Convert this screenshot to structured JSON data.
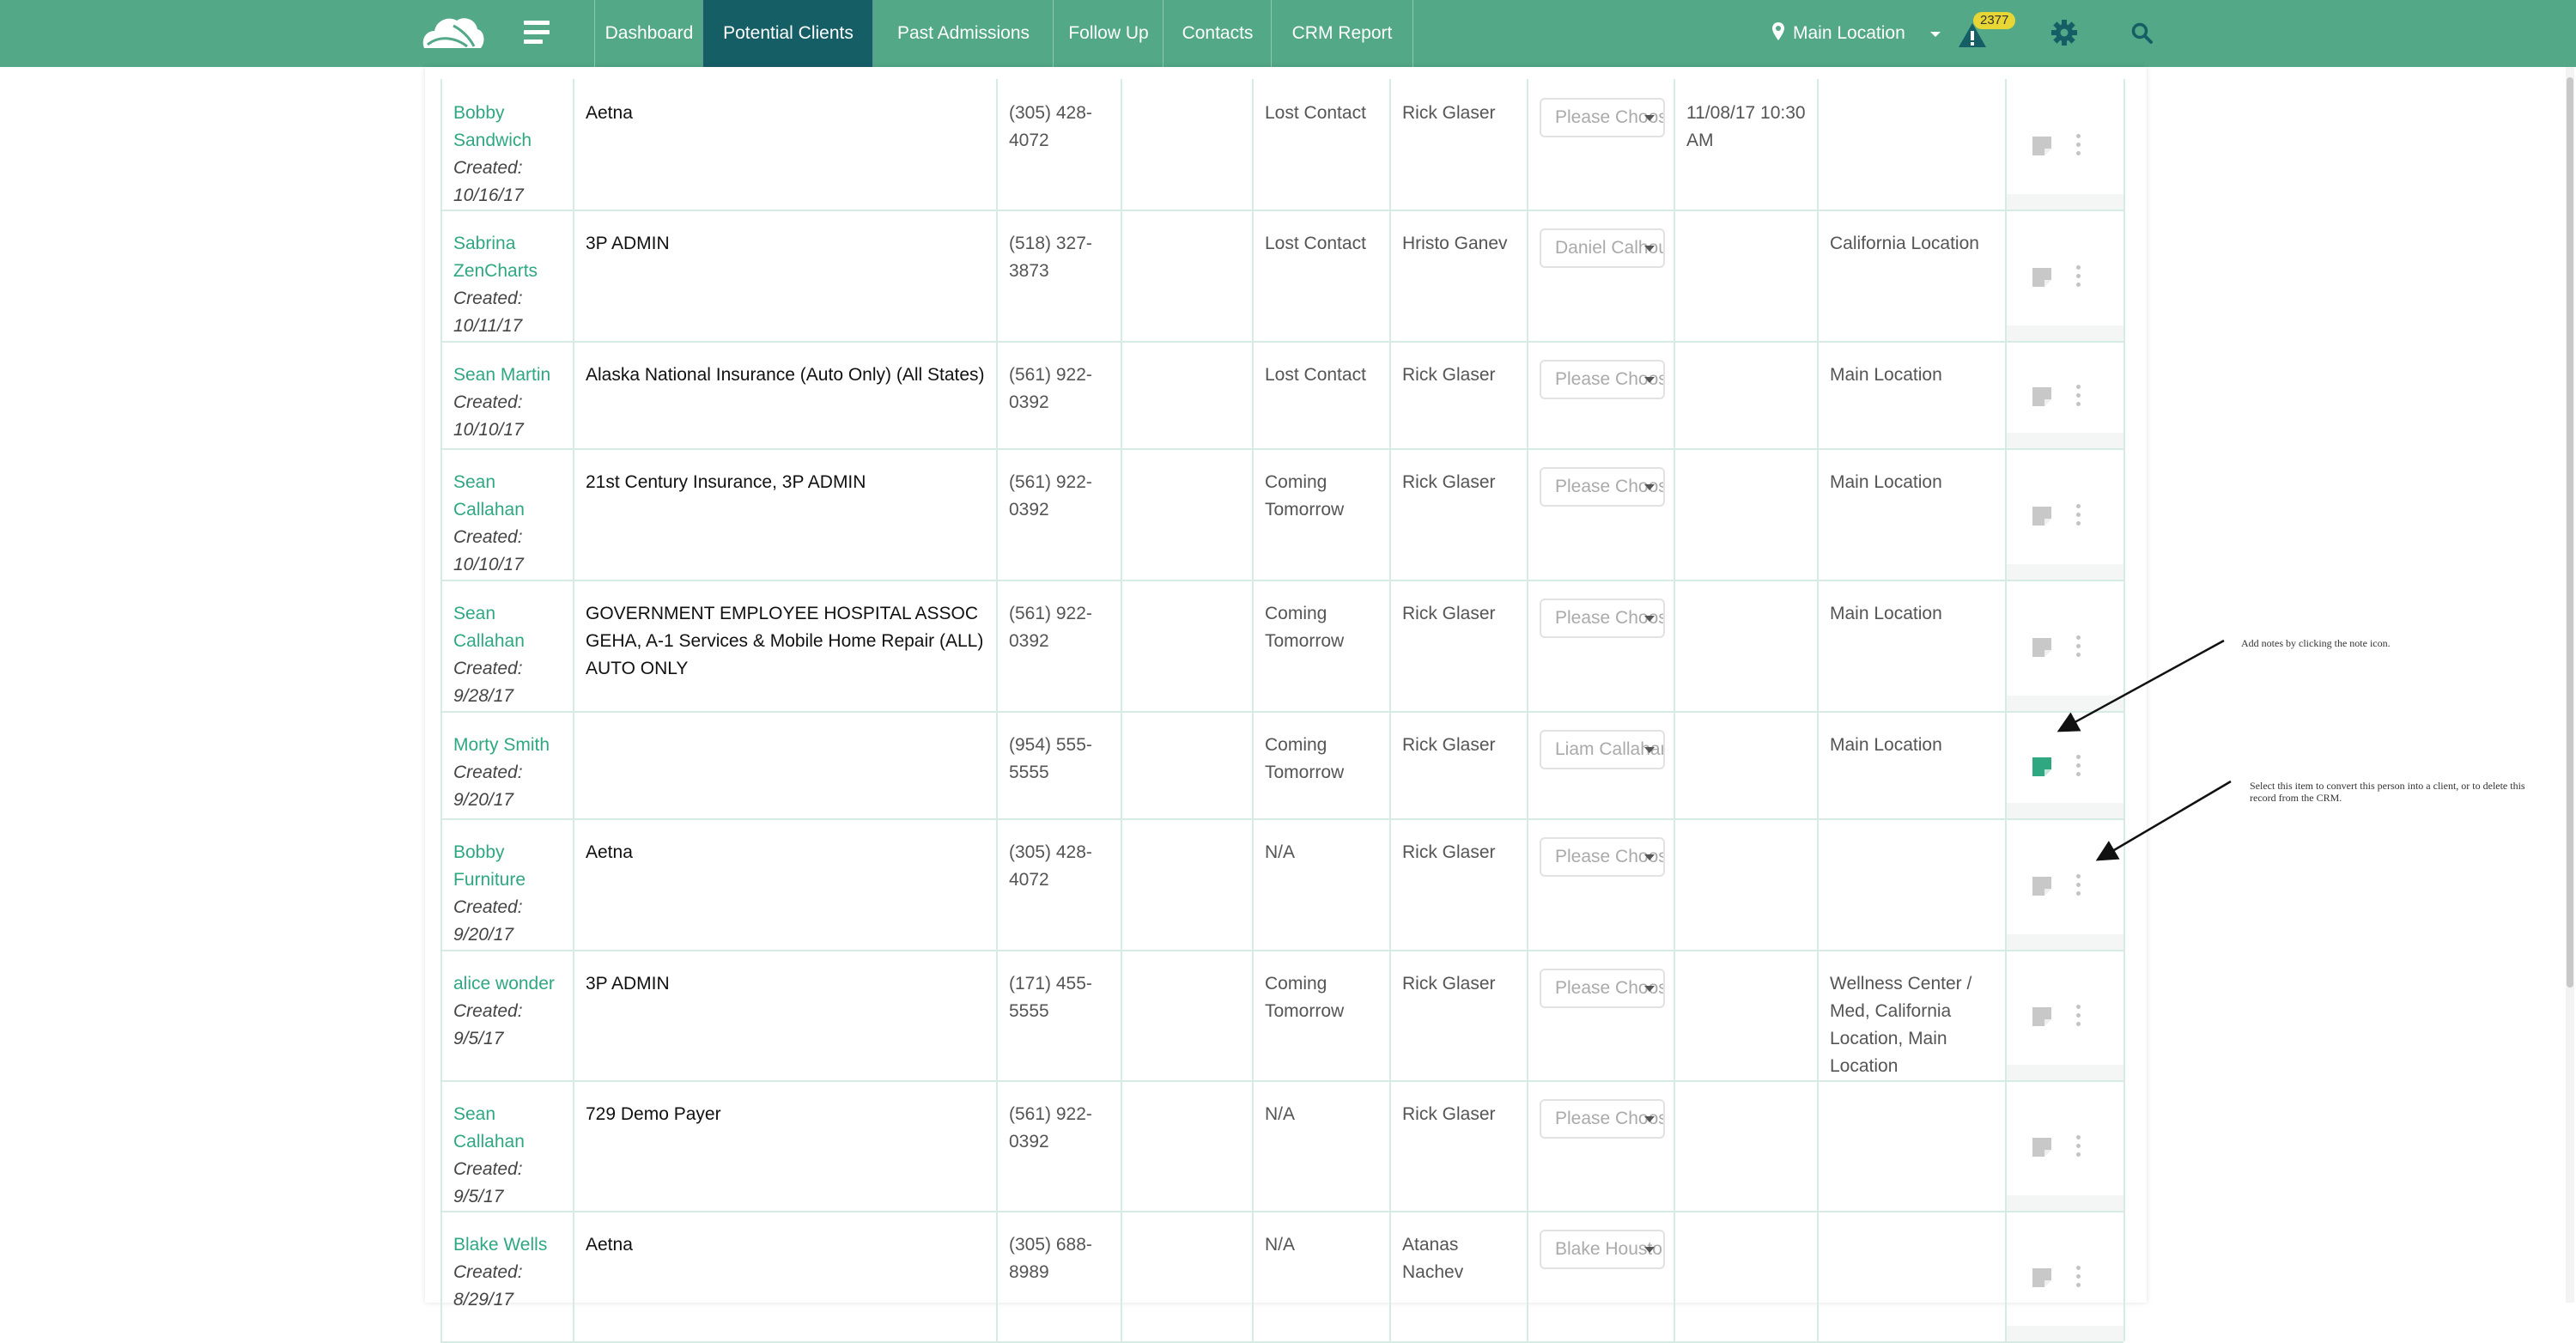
{
  "nav": {
    "tabs": [
      {
        "label": "Dashboard"
      },
      {
        "label": "Potential Clients"
      },
      {
        "label": "Past Admissions"
      },
      {
        "label": "Follow Up"
      },
      {
        "label": "Contacts"
      },
      {
        "label": "CRM Report"
      }
    ],
    "active_tab": "Potential Clients",
    "location_label": "Main Location",
    "alert_count": "2377",
    "icons": [
      "logo-icon",
      "menu-icon",
      "map-marker-icon",
      "caret-down-icon",
      "alert-icon",
      "gear-icon",
      "search-icon"
    ],
    "accent_color": "#52a887",
    "active_color": "#155e66"
  },
  "rows": [
    {
      "name": "Bobby Sandwich",
      "created": "Created: 10/16/17",
      "payer": "Aetna",
      "phone": "(305) 428-4072",
      "status": "Lost Contact",
      "staff": "Rick Glaser",
      "select": "Please Choose",
      "date": "11/08/17 10:30 AM",
      "location": "",
      "note_active": false
    },
    {
      "name": "Sabrina ZenCharts",
      "created": "Created: 10/11/17",
      "payer": "3P ADMIN",
      "phone": "(518) 327-3873",
      "status": "Lost Contact",
      "staff": "Hristo Ganev",
      "select": "Daniel Calhoun",
      "date": "",
      "location": "California Location",
      "note_active": false
    },
    {
      "name": "Sean Martin",
      "created": "Created: 10/10/17",
      "payer": "Alaska National Insurance (Auto Only) (All States)",
      "phone": "(561) 922-0392",
      "status": "Lost Contact",
      "staff": "Rick Glaser",
      "select": "Please Choose",
      "date": "",
      "location": "Main Location",
      "note_active": false
    },
    {
      "name": "Sean Callahan",
      "created": "Created: 10/10/17",
      "payer": "21st Century Insurance, 3P ADMIN",
      "phone": "(561) 922-0392",
      "status": "Coming Tomorrow",
      "staff": "Rick Glaser",
      "select": "Please Choose",
      "date": "",
      "location": "Main Location",
      "note_active": false
    },
    {
      "name": "Sean Callahan",
      "created": "Created: 9/28/17",
      "payer": "GOVERNMENT EMPLOYEE HOSPITAL ASSOC GEHA, A-1 Services & Mobile Home Repair (ALL) AUTO ONLY",
      "phone": "(561) 922-0392",
      "status": "Coming Tomorrow",
      "staff": "Rick Glaser",
      "select": "Please Choose",
      "date": "",
      "location": "Main Location",
      "note_active": false
    },
    {
      "name": "Morty Smith",
      "created": "Created: 9/20/17",
      "payer": "",
      "phone": "(954) 555-5555",
      "status": "Coming Tomorrow",
      "staff": "Rick Glaser",
      "select": "Liam Callahan",
      "date": "",
      "location": "Main Location",
      "note_active": true
    },
    {
      "name": "Bobby Furniture",
      "created": "Created: 9/20/17",
      "payer": "Aetna",
      "phone": "(305) 428-4072",
      "status": "N/A",
      "staff": "Rick Glaser",
      "select": "Please Choose",
      "date": "",
      "location": "",
      "note_active": false
    },
    {
      "name": "alice wonder",
      "created": "Created: 9/5/17",
      "payer": "3P ADMIN",
      "phone": "(171) 455-5555",
      "status": "Coming Tomorrow",
      "staff": "Rick Glaser",
      "select": "Please Choose",
      "date": "",
      "location": "Wellness Center / Med, California Location, Main Location",
      "note_active": false
    },
    {
      "name": "Sean Callahan",
      "created": "Created: 9/5/17",
      "payer": "729 Demo Payer",
      "phone": "(561) 922-0392",
      "status": "N/A",
      "staff": "Rick Glaser",
      "select": "Please Choose",
      "date": "",
      "location": "",
      "note_active": false
    },
    {
      "name": "Blake Wells",
      "created": "Created: 8/29/17",
      "payer": "Aetna",
      "phone": "(305) 688-8989",
      "status": "N/A",
      "staff": "Atanas Nachev",
      "select": "Blake Houston",
      "date": "",
      "location": "",
      "note_active": false
    }
  ],
  "annotations": {
    "note": "Add notes by clicking the note icon.",
    "convert": "Select this item to convert this person into a client, or to delete this record from the CRM."
  }
}
